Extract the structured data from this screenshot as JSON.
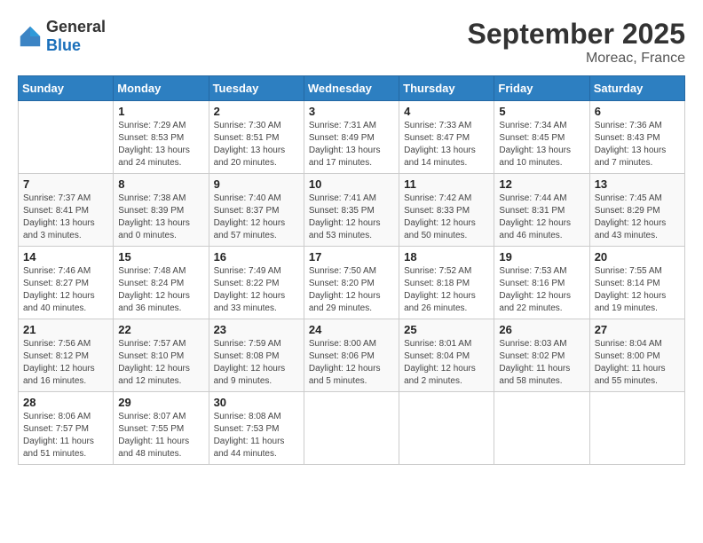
{
  "header": {
    "logo_general": "General",
    "logo_blue": "Blue",
    "month": "September 2025",
    "location": "Moreac, France"
  },
  "days_of_week": [
    "Sunday",
    "Monday",
    "Tuesday",
    "Wednesday",
    "Thursday",
    "Friday",
    "Saturday"
  ],
  "weeks": [
    [
      {
        "day": "",
        "sunrise": "",
        "sunset": "",
        "daylight": ""
      },
      {
        "day": "1",
        "sunrise": "Sunrise: 7:29 AM",
        "sunset": "Sunset: 8:53 PM",
        "daylight": "Daylight: 13 hours and 24 minutes."
      },
      {
        "day": "2",
        "sunrise": "Sunrise: 7:30 AM",
        "sunset": "Sunset: 8:51 PM",
        "daylight": "Daylight: 13 hours and 20 minutes."
      },
      {
        "day": "3",
        "sunrise": "Sunrise: 7:31 AM",
        "sunset": "Sunset: 8:49 PM",
        "daylight": "Daylight: 13 hours and 17 minutes."
      },
      {
        "day": "4",
        "sunrise": "Sunrise: 7:33 AM",
        "sunset": "Sunset: 8:47 PM",
        "daylight": "Daylight: 13 hours and 14 minutes."
      },
      {
        "day": "5",
        "sunrise": "Sunrise: 7:34 AM",
        "sunset": "Sunset: 8:45 PM",
        "daylight": "Daylight: 13 hours and 10 minutes."
      },
      {
        "day": "6",
        "sunrise": "Sunrise: 7:36 AM",
        "sunset": "Sunset: 8:43 PM",
        "daylight": "Daylight: 13 hours and 7 minutes."
      }
    ],
    [
      {
        "day": "7",
        "sunrise": "Sunrise: 7:37 AM",
        "sunset": "Sunset: 8:41 PM",
        "daylight": "Daylight: 13 hours and 3 minutes."
      },
      {
        "day": "8",
        "sunrise": "Sunrise: 7:38 AM",
        "sunset": "Sunset: 8:39 PM",
        "daylight": "Daylight: 13 hours and 0 minutes."
      },
      {
        "day": "9",
        "sunrise": "Sunrise: 7:40 AM",
        "sunset": "Sunset: 8:37 PM",
        "daylight": "Daylight: 12 hours and 57 minutes."
      },
      {
        "day": "10",
        "sunrise": "Sunrise: 7:41 AM",
        "sunset": "Sunset: 8:35 PM",
        "daylight": "Daylight: 12 hours and 53 minutes."
      },
      {
        "day": "11",
        "sunrise": "Sunrise: 7:42 AM",
        "sunset": "Sunset: 8:33 PM",
        "daylight": "Daylight: 12 hours and 50 minutes."
      },
      {
        "day": "12",
        "sunrise": "Sunrise: 7:44 AM",
        "sunset": "Sunset: 8:31 PM",
        "daylight": "Daylight: 12 hours and 46 minutes."
      },
      {
        "day": "13",
        "sunrise": "Sunrise: 7:45 AM",
        "sunset": "Sunset: 8:29 PM",
        "daylight": "Daylight: 12 hours and 43 minutes."
      }
    ],
    [
      {
        "day": "14",
        "sunrise": "Sunrise: 7:46 AM",
        "sunset": "Sunset: 8:27 PM",
        "daylight": "Daylight: 12 hours and 40 minutes."
      },
      {
        "day": "15",
        "sunrise": "Sunrise: 7:48 AM",
        "sunset": "Sunset: 8:24 PM",
        "daylight": "Daylight: 12 hours and 36 minutes."
      },
      {
        "day": "16",
        "sunrise": "Sunrise: 7:49 AM",
        "sunset": "Sunset: 8:22 PM",
        "daylight": "Daylight: 12 hours and 33 minutes."
      },
      {
        "day": "17",
        "sunrise": "Sunrise: 7:50 AM",
        "sunset": "Sunset: 8:20 PM",
        "daylight": "Daylight: 12 hours and 29 minutes."
      },
      {
        "day": "18",
        "sunrise": "Sunrise: 7:52 AM",
        "sunset": "Sunset: 8:18 PM",
        "daylight": "Daylight: 12 hours and 26 minutes."
      },
      {
        "day": "19",
        "sunrise": "Sunrise: 7:53 AM",
        "sunset": "Sunset: 8:16 PM",
        "daylight": "Daylight: 12 hours and 22 minutes."
      },
      {
        "day": "20",
        "sunrise": "Sunrise: 7:55 AM",
        "sunset": "Sunset: 8:14 PM",
        "daylight": "Daylight: 12 hours and 19 minutes."
      }
    ],
    [
      {
        "day": "21",
        "sunrise": "Sunrise: 7:56 AM",
        "sunset": "Sunset: 8:12 PM",
        "daylight": "Daylight: 12 hours and 16 minutes."
      },
      {
        "day": "22",
        "sunrise": "Sunrise: 7:57 AM",
        "sunset": "Sunset: 8:10 PM",
        "daylight": "Daylight: 12 hours and 12 minutes."
      },
      {
        "day": "23",
        "sunrise": "Sunrise: 7:59 AM",
        "sunset": "Sunset: 8:08 PM",
        "daylight": "Daylight: 12 hours and 9 minutes."
      },
      {
        "day": "24",
        "sunrise": "Sunrise: 8:00 AM",
        "sunset": "Sunset: 8:06 PM",
        "daylight": "Daylight: 12 hours and 5 minutes."
      },
      {
        "day": "25",
        "sunrise": "Sunrise: 8:01 AM",
        "sunset": "Sunset: 8:04 PM",
        "daylight": "Daylight: 12 hours and 2 minutes."
      },
      {
        "day": "26",
        "sunrise": "Sunrise: 8:03 AM",
        "sunset": "Sunset: 8:02 PM",
        "daylight": "Daylight: 11 hours and 58 minutes."
      },
      {
        "day": "27",
        "sunrise": "Sunrise: 8:04 AM",
        "sunset": "Sunset: 8:00 PM",
        "daylight": "Daylight: 11 hours and 55 minutes."
      }
    ],
    [
      {
        "day": "28",
        "sunrise": "Sunrise: 8:06 AM",
        "sunset": "Sunset: 7:57 PM",
        "daylight": "Daylight: 11 hours and 51 minutes."
      },
      {
        "day": "29",
        "sunrise": "Sunrise: 8:07 AM",
        "sunset": "Sunset: 7:55 PM",
        "daylight": "Daylight: 11 hours and 48 minutes."
      },
      {
        "day": "30",
        "sunrise": "Sunrise: 8:08 AM",
        "sunset": "Sunset: 7:53 PM",
        "daylight": "Daylight: 11 hours and 44 minutes."
      },
      {
        "day": "",
        "sunrise": "",
        "sunset": "",
        "daylight": ""
      },
      {
        "day": "",
        "sunrise": "",
        "sunset": "",
        "daylight": ""
      },
      {
        "day": "",
        "sunrise": "",
        "sunset": "",
        "daylight": ""
      },
      {
        "day": "",
        "sunrise": "",
        "sunset": "",
        "daylight": ""
      }
    ]
  ]
}
